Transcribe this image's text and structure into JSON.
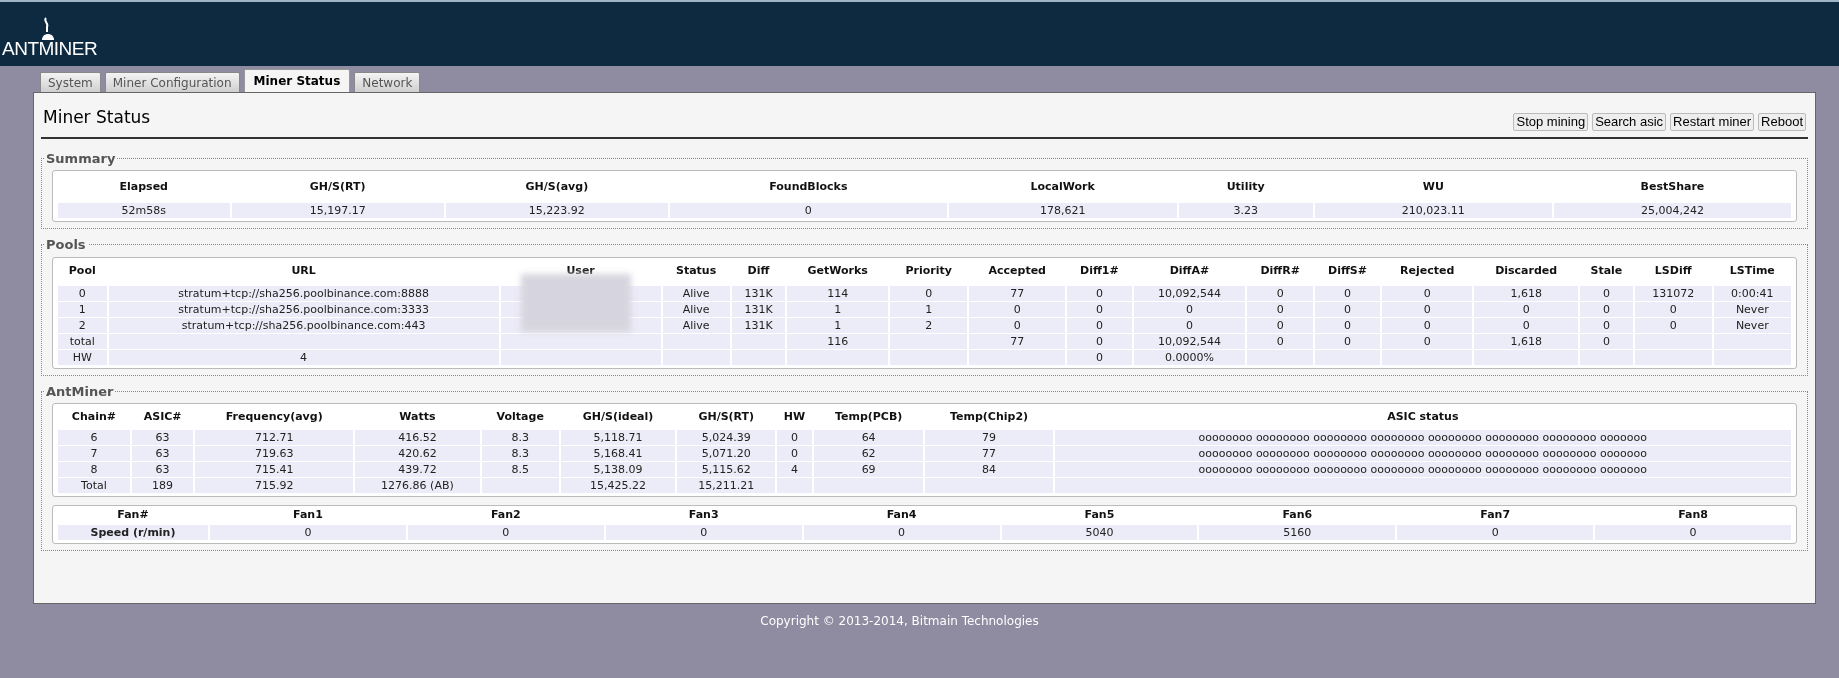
{
  "header": {
    "logo": "ANT**MINER**"
  },
  "tabs": [
    {
      "label": "System",
      "selected": false
    },
    {
      "label": "Miner Configuration",
      "selected": false
    },
    {
      "label": "Miner Status",
      "selected": true
    },
    {
      "label": "Network",
      "selected": false
    }
  ],
  "page_title": "Miner Status",
  "buttons": [
    "Stop mining",
    "Search asic",
    "Restart miner",
    "Reboot"
  ],
  "summary": {
    "legend": "Summary",
    "columns": [
      "Elapsed",
      "GH/S(RT)",
      "GH/S(avg)",
      "FoundBlocks",
      "LocalWork",
      "Utility",
      "WU",
      "BestShare"
    ],
    "rows": [
      [
        "52m58s",
        "15,197.17",
        "15,223.92",
        "0",
        "178,621",
        "3.23",
        "210,023.11",
        "25,004,242"
      ]
    ]
  },
  "pools": {
    "legend": "Pools",
    "user_blurred": true,
    "columns": [
      "Pool",
      "URL",
      "User",
      "Status",
      "Diff",
      "GetWorks",
      "Priority",
      "Accepted",
      "Diff1#",
      "DiffA#",
      "DiffR#",
      "DiffS#",
      "Rejected",
      "Discarded",
      "Stale",
      "LSDiff",
      "LSTime"
    ],
    "rows": [
      [
        "0",
        "stratum+tcp://sha256.poolbinance.com:8888",
        null,
        "Alive",
        "131K",
        "114",
        "0",
        "77",
        "0",
        "10,092,544",
        "0",
        "0",
        "0",
        "1,618",
        "0",
        "131072",
        "0:00:41"
      ],
      [
        "1",
        "stratum+tcp://sha256.poolbinance.com:3333",
        null,
        "Alive",
        "131K",
        "1",
        "1",
        "0",
        "0",
        "0",
        "0",
        "0",
        "0",
        "0",
        "0",
        "0",
        "Never"
      ],
      [
        "2",
        "stratum+tcp://sha256.poolbinance.com:443",
        null,
        "Alive",
        "131K",
        "1",
        "2",
        "0",
        "0",
        "0",
        "0",
        "0",
        "0",
        "0",
        "0",
        "0",
        "Never"
      ],
      [
        "total",
        null,
        null,
        null,
        null,
        "116",
        null,
        "77",
        "0",
        "10,092,544",
        "0",
        "0",
        "0",
        "1,618",
        "0",
        null,
        null
      ],
      [
        "HW",
        "4",
        null,
        null,
        null,
        null,
        null,
        null,
        "0",
        "0.0000%",
        null,
        null,
        null,
        null,
        null,
        null,
        null
      ]
    ]
  },
  "antminer": {
    "legend": "AntMiner",
    "columns": [
      "Chain#",
      "ASIC#",
      "Frequency(avg)",
      "Watts",
      "Voltage",
      "GH/S(ideal)",
      "GH/S(RT)",
      "HW",
      "Temp(PCB)",
      "Temp(Chip2)",
      "ASIC status"
    ],
    "rows": [
      [
        "6",
        "63",
        "712.71",
        "416.52",
        "8.3",
        "5,118.71",
        "5,024.39",
        "0",
        "64",
        "79",
        "oooooooo oooooooo oooooooo oooooooo oooooooo oooooooo oooooooo ooooooo"
      ],
      [
        "7",
        "63",
        "719.63",
        "420.62",
        "8.3",
        "5,168.41",
        "5,071.20",
        "0",
        "62",
        "77",
        "oooooooo oooooooo oooooooo oooooooo oooooooo oooooooo oooooooo ooooooo"
      ],
      [
        "8",
        "63",
        "715.41",
        "439.72",
        "8.5",
        "5,138.09",
        "5,115.62",
        "4",
        "69",
        "84",
        "oooooooo oooooooo oooooooo oooooooo oooooooo oooooooo oooooooo ooooooo"
      ],
      [
        "Total",
        "189",
        "715.92",
        "1276.86 (AB)",
        null,
        "15,425.22",
        "15,211.21",
        null,
        null,
        null,
        null
      ]
    ],
    "fans": {
      "columns": [
        "Fan#",
        "Fan1",
        "Fan2",
        "Fan3",
        "Fan4",
        "Fan5",
        "Fan6",
        "Fan7",
        "Fan8"
      ],
      "rows": [
        [
          "Speed (r/min)",
          "0",
          "0",
          "0",
          "0",
          "5040",
          "5160",
          "0",
          "0"
        ]
      ]
    }
  },
  "footer": "Copyright © 2013-2014, Bitmain Technologies"
}
